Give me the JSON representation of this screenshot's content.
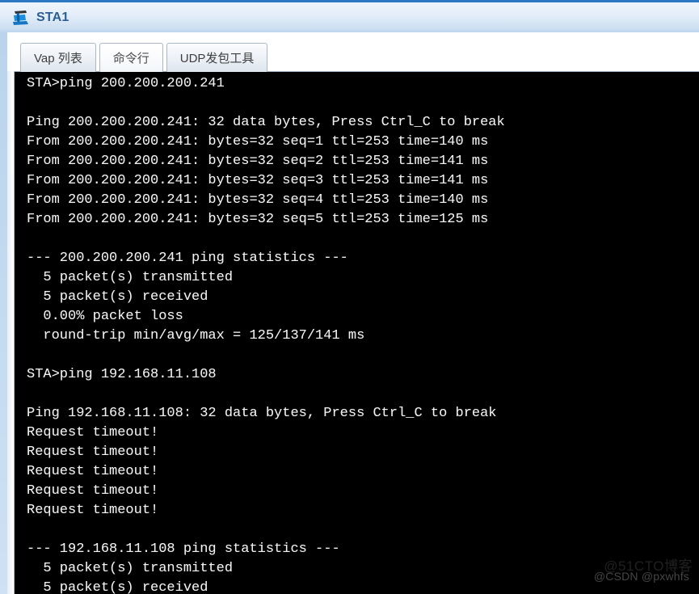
{
  "window": {
    "title": "STA1",
    "icon": "laptop-device-icon"
  },
  "tabs": [
    {
      "id": "vap-list",
      "label": "Vap 列表",
      "active": false
    },
    {
      "id": "cli",
      "label": "命令行",
      "active": true
    },
    {
      "id": "udp-tool",
      "label": "UDP发包工具",
      "active": false
    }
  ],
  "terminal": {
    "prompt": "STA>",
    "background": "#000000",
    "foreground": "#f2f2f2",
    "lines": [
      "STA>ping 200.200.200.241",
      "",
      "Ping 200.200.200.241: 32 data bytes, Press Ctrl_C to break",
      "From 200.200.200.241: bytes=32 seq=1 ttl=253 time=140 ms",
      "From 200.200.200.241: bytes=32 seq=2 ttl=253 time=141 ms",
      "From 200.200.200.241: bytes=32 seq=3 ttl=253 time=141 ms",
      "From 200.200.200.241: bytes=32 seq=4 ttl=253 time=140 ms",
      "From 200.200.200.241: bytes=32 seq=5 ttl=253 time=125 ms",
      "",
      "--- 200.200.200.241 ping statistics ---",
      "  5 packet(s) transmitted",
      "  5 packet(s) received",
      "  0.00% packet loss",
      "  round-trip min/avg/max = 125/137/141 ms",
      "",
      "STA>ping 192.168.11.108",
      "",
      "Ping 192.168.11.108: 32 data bytes, Press Ctrl_C to break",
      "Request timeout!",
      "Request timeout!",
      "Request timeout!",
      "Request timeout!",
      "Request timeout!",
      "",
      "--- 192.168.11.108 ping statistics ---",
      "  5 packet(s) transmitted",
      "  5 packet(s) received"
    ]
  },
  "watermarks": {
    "primary": "@51CTO博客",
    "secondary": "@CSDN @pxwhfs"
  },
  "colors": {
    "titlebar_top_border": "#2b79c2",
    "title_text": "#2a5f93",
    "terminal_bg": "#000000",
    "terminal_fg": "#f2f2f2",
    "tab_border": "#a9b7c6"
  }
}
